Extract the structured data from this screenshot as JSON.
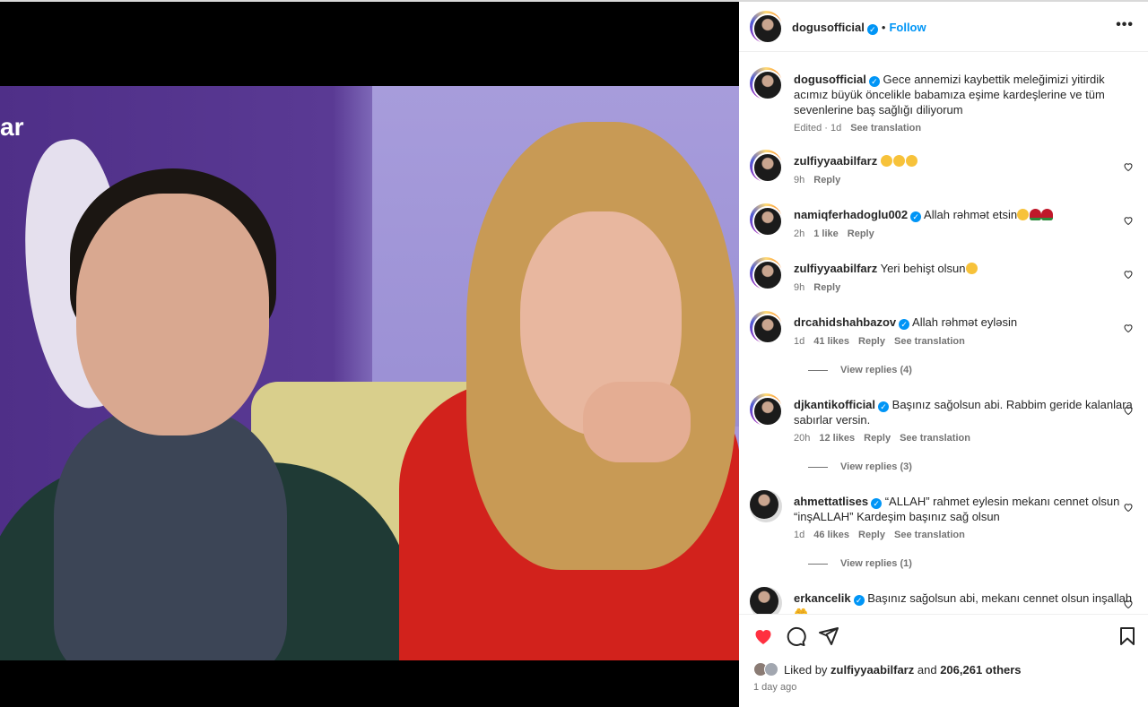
{
  "post": {
    "username": "dogusofficial",
    "follow_label": "Follow",
    "separator": "•",
    "more": "•••",
    "caption": "Gece annemizi kaybettik meleğimizi yitirdik acımız büyük öncelikle babamıza eşime kardeşlerine ve tüm sevenlerine baş sağlığı diliyorum",
    "caption_meta": "Edited · 1d",
    "see_translation": "See translation",
    "image_logo_text": "ar"
  },
  "comments": [
    {
      "user": "zulfiyyaabilfarz",
      "verified": false,
      "text": "😦😦😦",
      "time": "9h",
      "likes": "",
      "reply": "Reply",
      "translate": ""
    },
    {
      "user": "namiqferhadoglu002",
      "verified": true,
      "text": "Allah rəhmət etsin🤲🥀🥀",
      "time": "2h",
      "likes": "1 like",
      "reply": "Reply",
      "translate": ""
    },
    {
      "user": "zulfiyyaabilfarz",
      "verified": false,
      "text": "Yeri behişt olsun🤲",
      "time": "9h",
      "likes": "",
      "reply": "Reply",
      "translate": ""
    },
    {
      "user": "drcahidshahbazov",
      "verified": true,
      "text": "Allah rəhmət eyləsin",
      "time": "1d",
      "likes": "41 likes",
      "reply": "Reply",
      "translate": "See translation",
      "view_replies": "View replies (4)"
    },
    {
      "user": "djkantikofficial",
      "verified": true,
      "text": "Başınız sağolsun abi. Rabbim geride kalanlara sabırlar versin.",
      "time": "20h",
      "likes": "12 likes",
      "reply": "Reply",
      "translate": "See translation",
      "view_replies": "View replies (3)"
    },
    {
      "user": "ahmettatlises",
      "verified": true,
      "text": "“ALLAH” rahmet eylesin mekanı cennet olsun “inşALLAH” Kardeşim başınız sağ olsun",
      "time": "1d",
      "likes": "46 likes",
      "reply": "Reply",
      "translate": "See translation",
      "view_replies": "View replies (1)"
    },
    {
      "user": "erkancelik",
      "verified": true,
      "text": "Başınız sağolsun abi, mekanı cennet olsun inşallah 🤲",
      "time": "",
      "likes": "",
      "reply": "",
      "translate": ""
    }
  ],
  "footer": {
    "liked_by_prefix": "Liked by",
    "liked_by_user": "zulfiyyaabilfarz",
    "and": "and",
    "others": "206,261 others",
    "time_ago": "1 day ago"
  },
  "colors": {
    "accent": "#0095f6",
    "like": "#ff3040",
    "text": "#262626",
    "muted": "#737373"
  },
  "icons": [
    "heart-icon",
    "comment-icon",
    "share-icon",
    "bookmark-icon",
    "more-icon",
    "verified-icon"
  ]
}
